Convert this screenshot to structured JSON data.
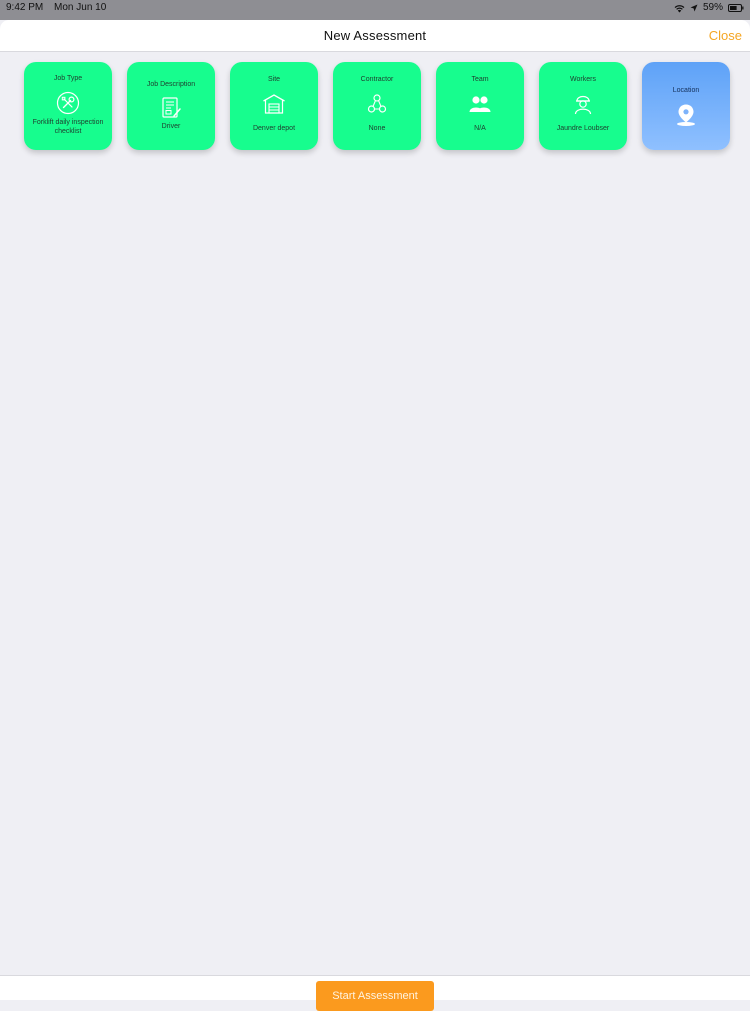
{
  "status": {
    "time": "9:42 PM",
    "date": "Mon Jun 10",
    "battery_percent": "59%",
    "icons": [
      "wifi-icon",
      "location-arrow-icon",
      "battery-icon"
    ]
  },
  "nav": {
    "title": "New Assessment",
    "close_label": "Close"
  },
  "tiles": [
    {
      "label": "Job Type",
      "value": "Forklift daily inspection checklist",
      "icon": "tools-icon"
    },
    {
      "label": "Job Description",
      "value": "Driver",
      "icon": "document-icon"
    },
    {
      "label": "Site",
      "value": "Denver depot",
      "icon": "warehouse-icon"
    },
    {
      "label": "Contractor",
      "value": "None",
      "icon": "contractor-icon"
    },
    {
      "label": "Team",
      "value": "N/A",
      "icon": "team-icon"
    },
    {
      "label": "Workers",
      "value": "Jaundre Loubser",
      "icon": "worker-icon"
    },
    {
      "label": "Location",
      "value": "",
      "icon": "location-pin-icon"
    }
  ],
  "footer": {
    "start_label": "Start Assessment"
  },
  "colors": {
    "tile_complete": "#17fd8e",
    "tile_active": "#6aabfa",
    "accent": "#f5a623",
    "button": "#fb9a1e"
  }
}
